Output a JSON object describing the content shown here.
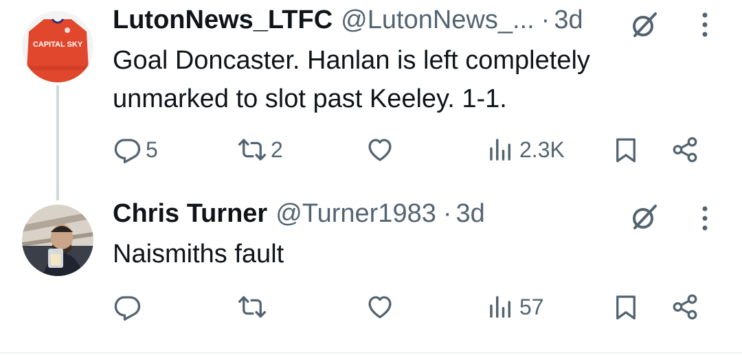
{
  "tweets": [
    {
      "display_name": "LutonNews_LTFC",
      "handle": "@LutonNews_...",
      "separator": "·",
      "time": "3d",
      "text_lines": [
        "Goal Doncaster. Hanlan is left completely",
        "unmarked to slot past Keeley. 1-1."
      ],
      "avatar_text": "CAPITAL SKY",
      "reply_count": "5",
      "retweet_count": "2",
      "like_count": "",
      "view_count": "2.3K"
    },
    {
      "display_name": "Chris Turner",
      "handle": "@Turner1983",
      "separator": "·",
      "time": "3d",
      "text_lines": [
        "Naismiths fault"
      ],
      "reply_count": "",
      "retweet_count": "",
      "like_count": "",
      "view_count": "57"
    }
  ],
  "colors": {
    "text_primary": "#0f1419",
    "text_secondary": "#536471",
    "thread_line": "#cfd9de",
    "shirt_red": "#e0472c"
  },
  "icons": [
    "reply-icon",
    "retweet-icon",
    "like-icon",
    "views-icon",
    "bookmark-icon",
    "share-icon",
    "grok-icon",
    "more-icon"
  ]
}
